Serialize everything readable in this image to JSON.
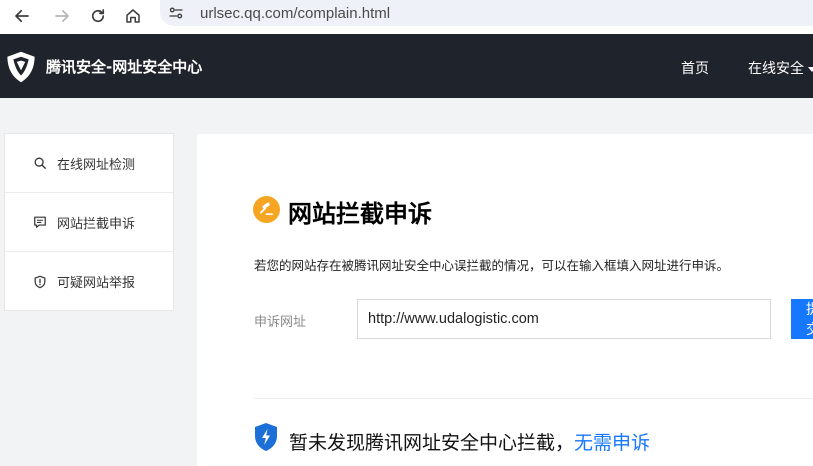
{
  "browser": {
    "url": "urlsec.qq.com/complain.html"
  },
  "header": {
    "title": "腾讯安全-网址安全中心",
    "nav": [
      {
        "label": "首页",
        "dropdown": false
      },
      {
        "label": "在线安全",
        "dropdown": true
      }
    ]
  },
  "sidebar": {
    "items": [
      {
        "label": "在线网址检测",
        "icon": "search-icon"
      },
      {
        "label": "网站拦截申诉",
        "icon": "chat-icon"
      },
      {
        "label": "可疑网站举报",
        "icon": "shield-alert-icon"
      }
    ]
  },
  "main": {
    "heading": "网站拦截申诉",
    "description": "若您的网站存在被腾讯网址安全中心误拦截的情况，可以在输入框填入网址进行申诉。",
    "form": {
      "label": "申诉网址",
      "input_value": "http://www.udalogistic.com",
      "submit_label": "提交"
    },
    "result": {
      "text": "暂未发现腾讯网址安全中心拦截，",
      "link": "无需申诉"
    }
  },
  "colors": {
    "header_bg": "#1f232b",
    "accent": "#1677ff",
    "heading_icon": "#f6a623",
    "result_icon": "#1b6fd6"
  }
}
